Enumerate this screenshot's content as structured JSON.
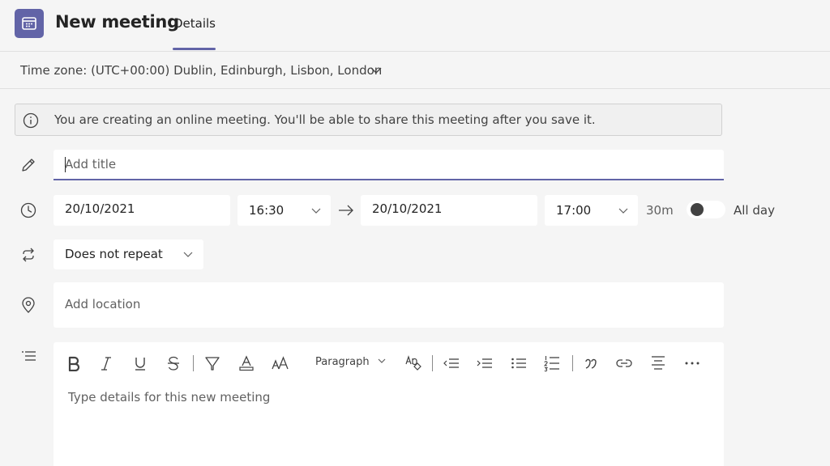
{
  "header": {
    "title": "New meeting",
    "tabs": [
      {
        "label": "Details",
        "active": true
      }
    ],
    "accent": "#6264a7"
  },
  "timezone": {
    "label": "Time zone: (UTC+00:00) Dublin, Edinburgh, Lisbon, London"
  },
  "banner": {
    "text": "You are creating an online meeting. You'll be able to share this meeting after you save it."
  },
  "form": {
    "title": {
      "placeholder": "Add title",
      "value": ""
    },
    "start_date": "20/10/2021",
    "start_time": "16:30",
    "end_date": "20/10/2021",
    "end_time": "17:00",
    "duration": "30m",
    "all_day": {
      "label": "All day",
      "checked": false
    },
    "repeat": "Does not repeat",
    "location": {
      "placeholder": "Add location",
      "value": ""
    }
  },
  "editor": {
    "paragraph_label": "Paragraph",
    "placeholder": "Type details for this new meeting",
    "toolbar": [
      "bold-icon",
      "italic-icon",
      "underline-icon",
      "strikethrough-icon",
      "highlight-icon",
      "font-color-icon",
      "font-size-icon",
      "paragraph-dropdown",
      "clear-formatting-icon",
      "outdent-icon",
      "indent-icon",
      "bullet-list-icon",
      "numbered-list-icon",
      "quote-icon",
      "link-icon",
      "align-icon",
      "more-icon"
    ]
  }
}
